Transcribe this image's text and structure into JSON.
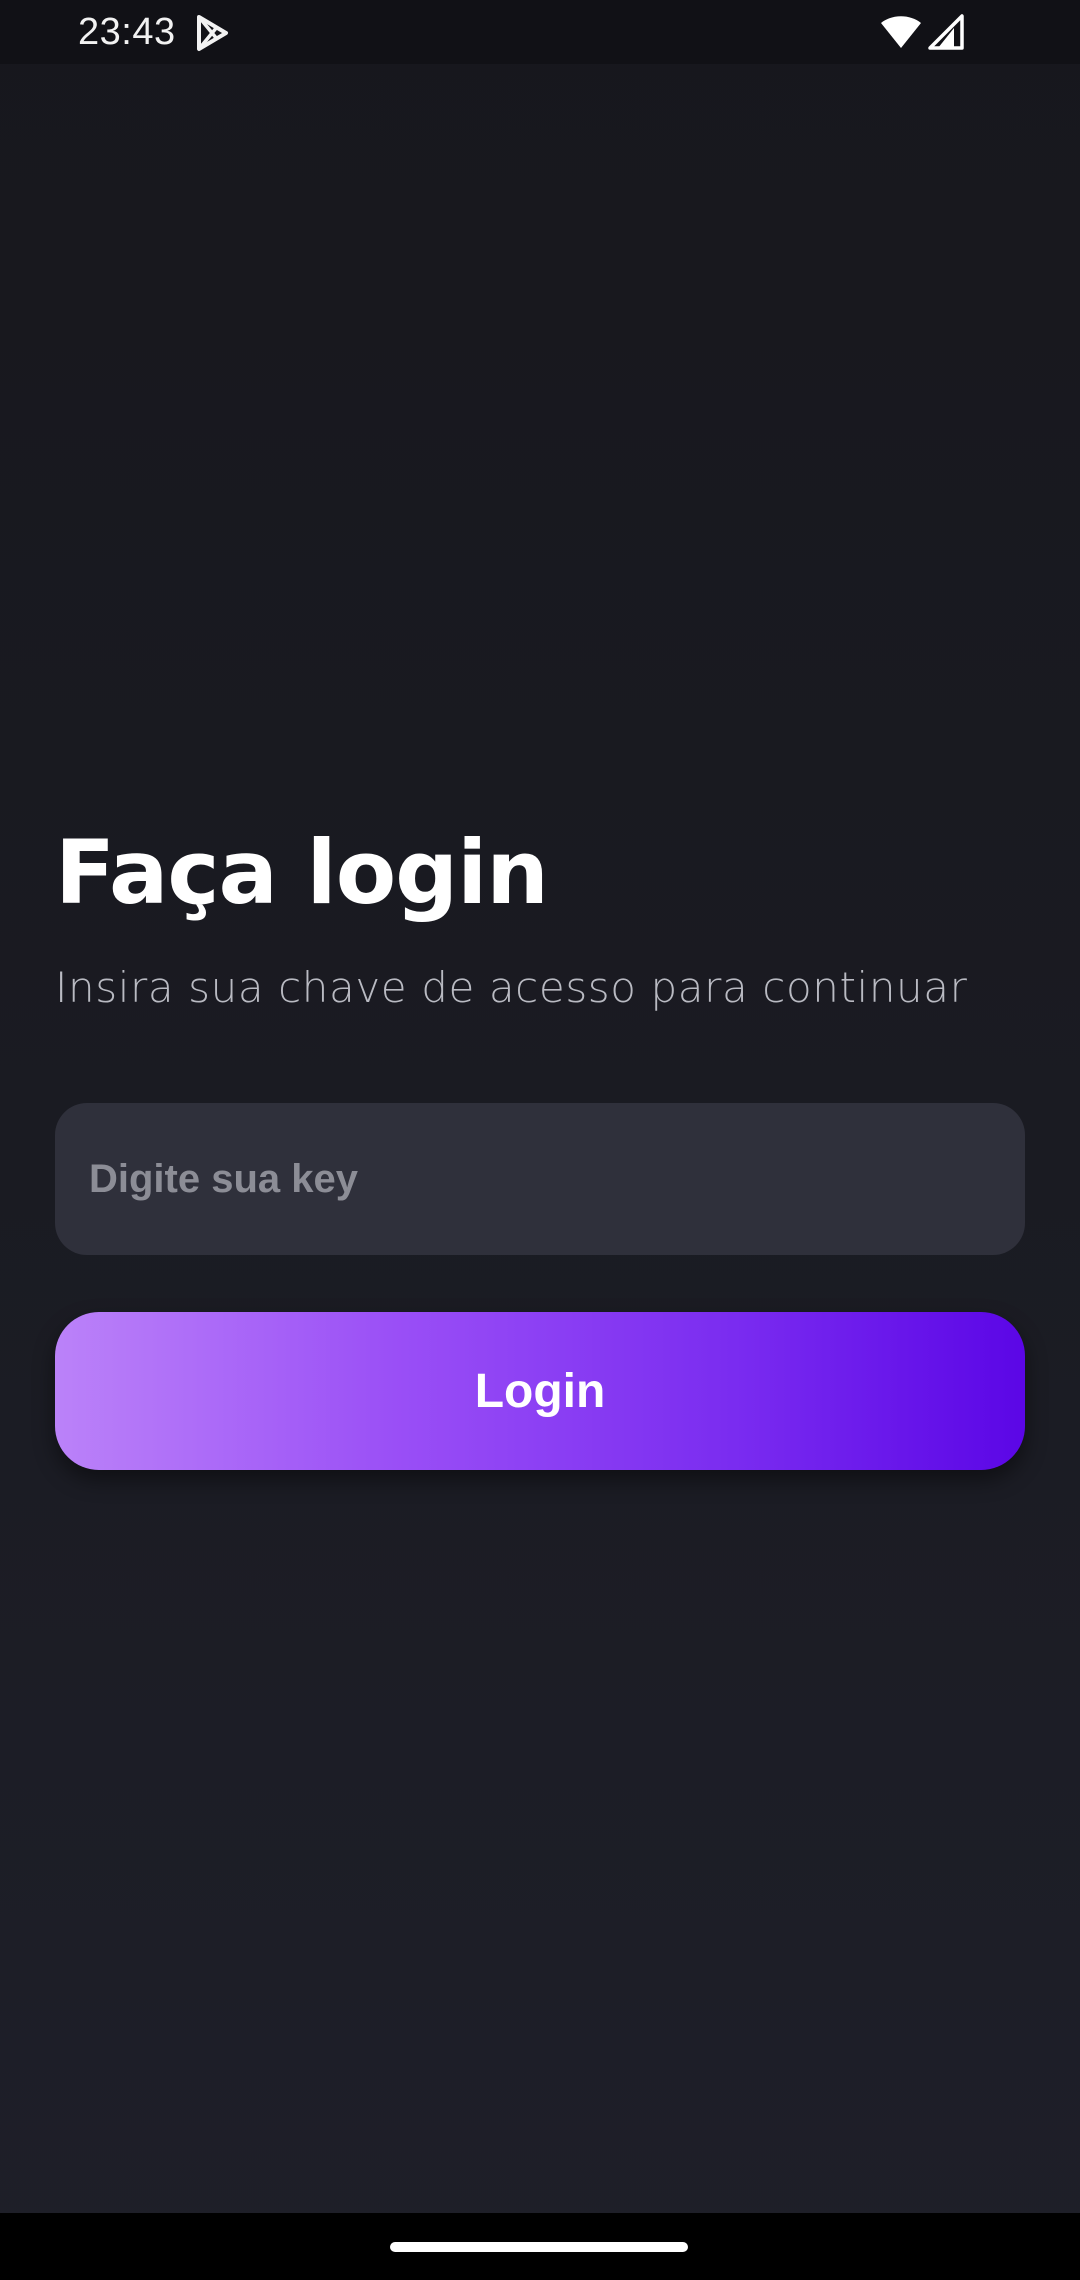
{
  "status_bar": {
    "time": "23:43",
    "icons": [
      "play-store-icon",
      "wifi-icon",
      "signal-icon"
    ]
  },
  "login": {
    "title": "Faça login",
    "subtitle": "Insira sua chave de acesso para continuar",
    "key_input": {
      "placeholder": "Digite sua key",
      "value": ""
    },
    "button_label": "Login"
  },
  "colors": {
    "background": "#1a1b22",
    "input_background": "#2f303b",
    "button_gradient_start": "#bb82f9",
    "button_gradient_end": "#5b06e6",
    "title": "#ffffff",
    "subtitle": "#b9bac2"
  }
}
